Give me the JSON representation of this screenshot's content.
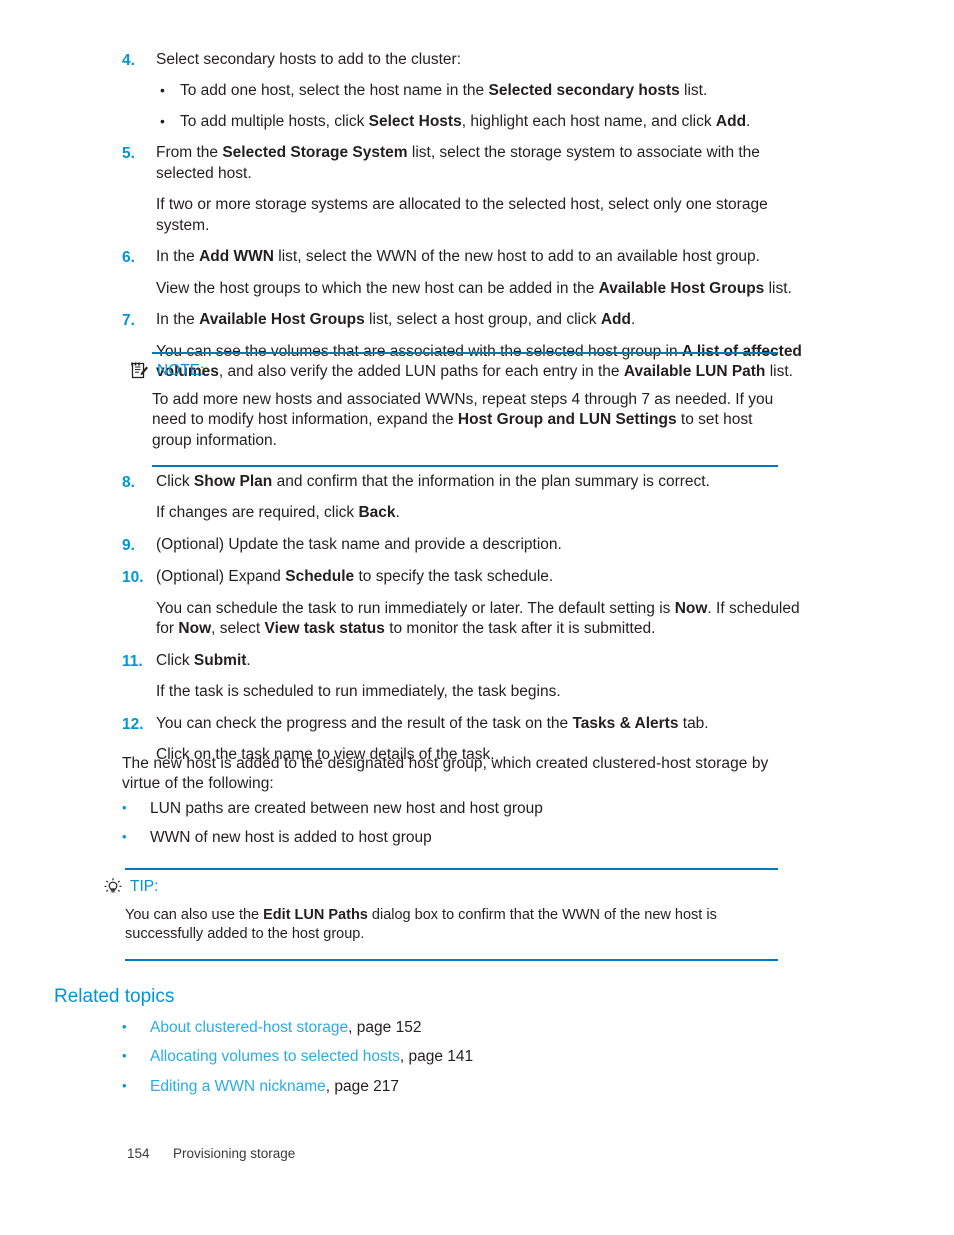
{
  "colors": {
    "accent_blue": "#0096d6",
    "rule_blue": "#0079c1",
    "link_blue": "#2bace2",
    "body_text": "#231f20"
  },
  "steps": [
    {
      "number": "4.",
      "text": "Select secondary hosts to add to the cluster:",
      "sub_bullets": [
        "To add one host, select the host name in the Selected secondary hosts list.",
        "To add multiple hosts, click Select Hosts, highlight each host name, and click Add."
      ]
    },
    {
      "number": "5.",
      "text": "From the Selected Storage System list, select the storage system to associate with the selected host.",
      "follow": "If two or more storage systems are allocated to the selected host, select only one storage system."
    },
    {
      "number": "6.",
      "text": "In the Add WWN list, select the WWN of the new host to add to an available host group.",
      "follow": "View the host groups to which the new host can be added in the Available Host Groups list."
    },
    {
      "number": "7.",
      "text": "In the Available Host Groups list, select a host group, and click Add.",
      "follow": "You can see the volumes that are associated with the selected host group in A list of affected volumes, and also verify the added LUN paths for each entry in the Available LUN Path list."
    }
  ],
  "note": {
    "icon": "note-pencil-icon",
    "label": "NOTE:",
    "body": "To add more new hosts and associated WWNs, repeat steps 4 through 7 as needed. If you need to modify host information, expand the Host Group and LUN Settings to set host group information."
  },
  "steps2": [
    {
      "number": "8.",
      "text": "Click Show Plan and confirm that the information in the plan summary is correct.",
      "follow": "If changes are required, click Back."
    },
    {
      "number": "9.",
      "text": "(Optional) Update the task name and provide a description."
    },
    {
      "number": "10.",
      "text": "(Optional) Expand Schedule to specify the task schedule.",
      "follow": "You can schedule the task to run immediately or later. The default setting is Now. If scheduled for Now, select View task status to monitor the task after it is submitted."
    },
    {
      "number": "11.",
      "text": "Click Submit.",
      "follow": "If the task is scheduled to run immediately, the task begins."
    },
    {
      "number": "12.",
      "text": "You can check the progress and the result of the task on the Tasks & Alerts tab.",
      "follow": "Click on the task name to view details of the task."
    }
  ],
  "closing": {
    "paragraph": "The new host is added to the designated host group, which created clustered-host storage by virtue of the following:",
    "bullets": [
      "LUN paths are created between new host and host group",
      "WWN of new host is added to host group"
    ]
  },
  "tip": {
    "icon": "lightbulb-icon",
    "label": "TIP:",
    "body": "You can also use the Edit LUN Paths dialog box to confirm that the WWN of the new host is successfully added to the host group."
  },
  "related": {
    "heading": "Related topics",
    "items": [
      {
        "link": "About clustered-host storage",
        "page": ", page 152"
      },
      {
        "link": "Allocating volumes to selected hosts",
        "page": ", page 141"
      },
      {
        "link": "Editing a WWN nickname",
        "page": ", page 217"
      }
    ]
  },
  "footer": {
    "page_number": "154",
    "section": "Provisioning storage"
  }
}
